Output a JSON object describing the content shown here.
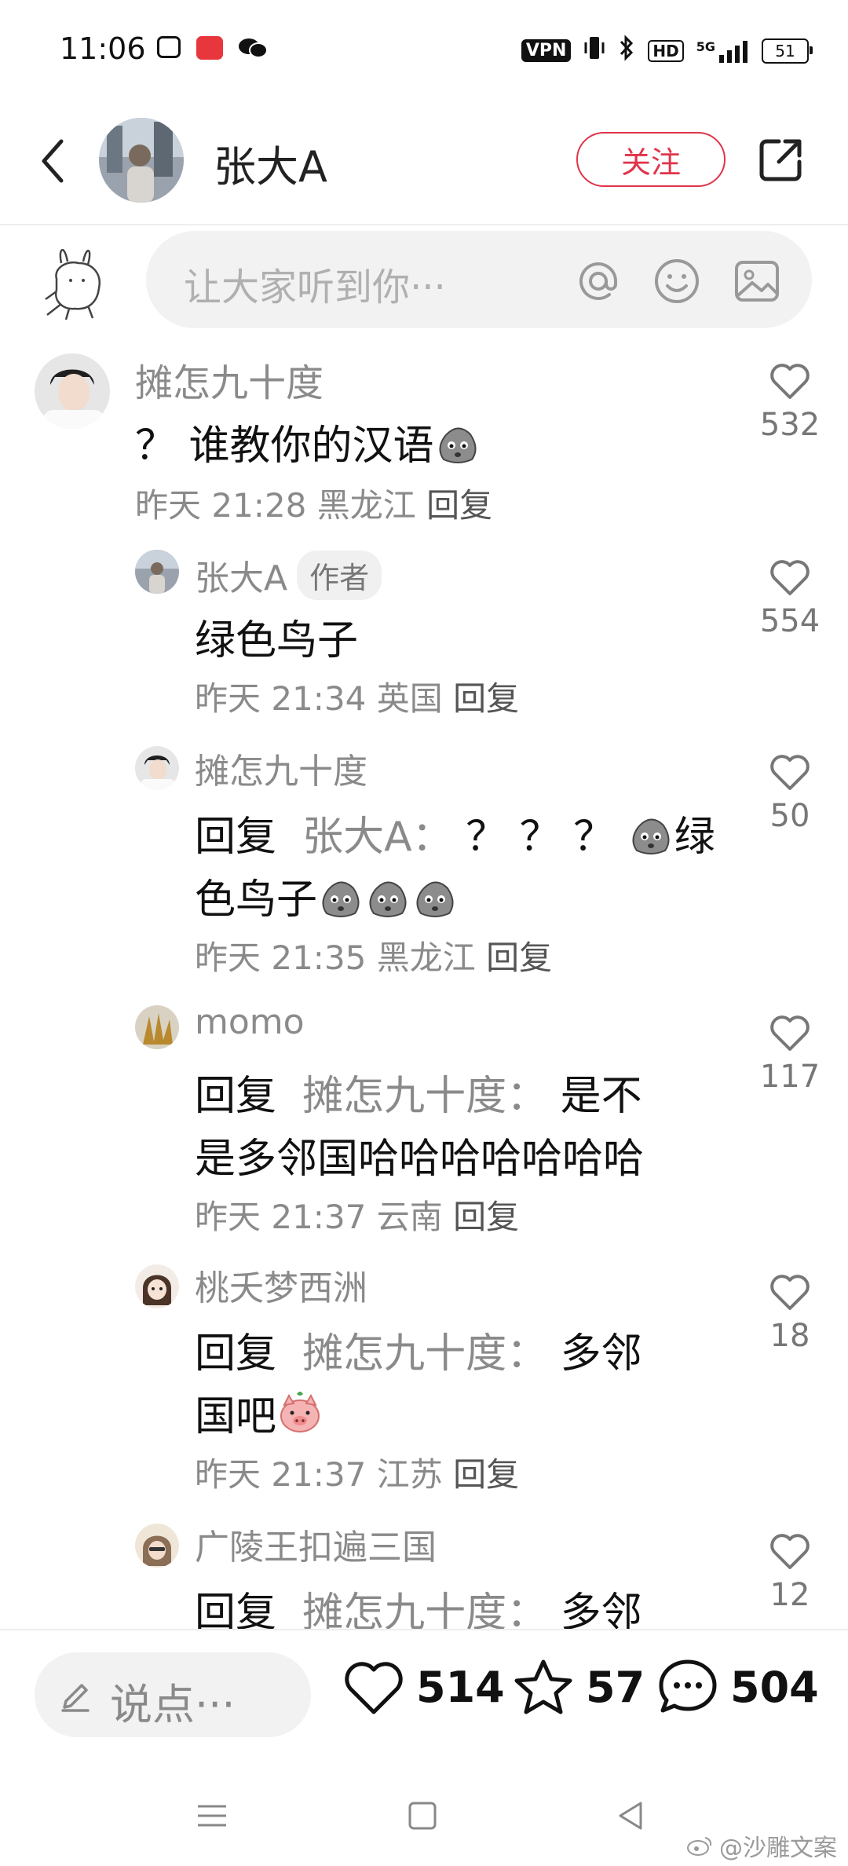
{
  "status_bar": {
    "time": "11:06",
    "vpn": "VPN",
    "hd": "HD",
    "network": "5G",
    "battery": "51"
  },
  "header": {
    "title": "张大A",
    "follow_label": "关注"
  },
  "input": {
    "placeholder": "让大家听到你···"
  },
  "comments": [
    {
      "name": "摊怎九十度",
      "text": "？ 谁教你的汉语",
      "time": "昨天 21:28",
      "location": "黑龙江",
      "reply": "回复",
      "likes": "532"
    },
    {
      "name": "张大A",
      "tag": "作者",
      "text": "绿色鸟子",
      "time": "昨天 21:34",
      "location": "英国",
      "reply": "回复",
      "likes": "554"
    },
    {
      "name": "摊怎九十度",
      "prefix": "回复",
      "target": "张大A：",
      "text_a": "？ ？ ？",
      "text_b": "绿",
      "text_c": "色鸟子",
      "time": "昨天 21:35",
      "location": "黑龙江",
      "reply": "回复",
      "likes": "50"
    },
    {
      "name": "momo",
      "prefix": "回复",
      "target": "摊怎九十度：",
      "text_a": "是不",
      "text_b": "是多邻国哈哈哈哈哈哈哈",
      "time": "昨天 21:37",
      "location": "云南",
      "reply": "回复",
      "likes": "117"
    },
    {
      "name": "桃夭梦西洲",
      "prefix": "回复",
      "target": "摊怎九十度：",
      "text_a": "多邻",
      "text_b": "国吧",
      "time": "昨天 21:37",
      "location": "江苏",
      "reply": "回复",
      "likes": "18"
    },
    {
      "name": "广陵王扣遍三国",
      "prefix": "回复",
      "target": "摊怎九十度：",
      "text_a": "多邻",
      "likes": "12"
    }
  ],
  "bottom_bar": {
    "say_placeholder": "说点···",
    "likes": "514",
    "favorites": "57",
    "comments": "504"
  },
  "watermark": "@沙雕文案",
  "colors": {
    "accent": "#e0344a",
    "muted_text": "#8a8a8a",
    "input_bg": "#f2f2f2"
  }
}
